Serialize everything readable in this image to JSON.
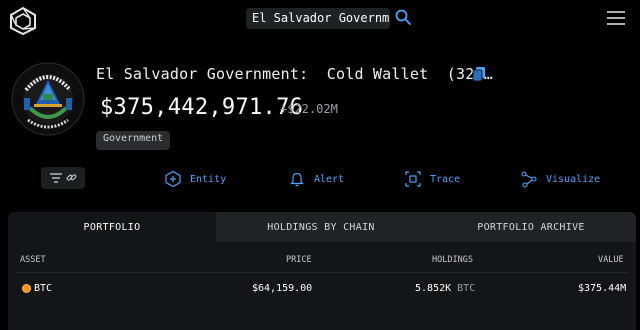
{
  "search": {
    "value": "El Salvador Government"
  },
  "entity": {
    "title": "El Salvador Government:  Cold Wallet  (32i…",
    "value": "$375,442,971.76",
    "change": "+$22.02M",
    "tag": "Government"
  },
  "actions": [
    {
      "label": "Entity",
      "icon": "entity-icon"
    },
    {
      "label": "Alert",
      "icon": "bell-icon"
    },
    {
      "label": "Trace",
      "icon": "trace-icon"
    },
    {
      "label": "Visualize",
      "icon": "visualize-icon"
    }
  ],
  "tabs": [
    {
      "label": "PORTFOLIO",
      "active": true
    },
    {
      "label": "HOLDINGS BY CHAIN",
      "active": false
    },
    {
      "label": "PORTFOLIO ARCHIVE",
      "active": false
    }
  ],
  "table": {
    "columns": [
      "ASSET",
      "PRICE",
      "HOLDINGS",
      "VALUE"
    ],
    "rows": [
      {
        "asset": "BTC",
        "price": "$64,159.00",
        "holdings": "5.852K",
        "holdings_unit": "BTC",
        "value": "$375.44M"
      }
    ]
  },
  "colors": {
    "accent": "#4aa3ff",
    "btc": "#f7931a",
    "background": "#000000"
  }
}
